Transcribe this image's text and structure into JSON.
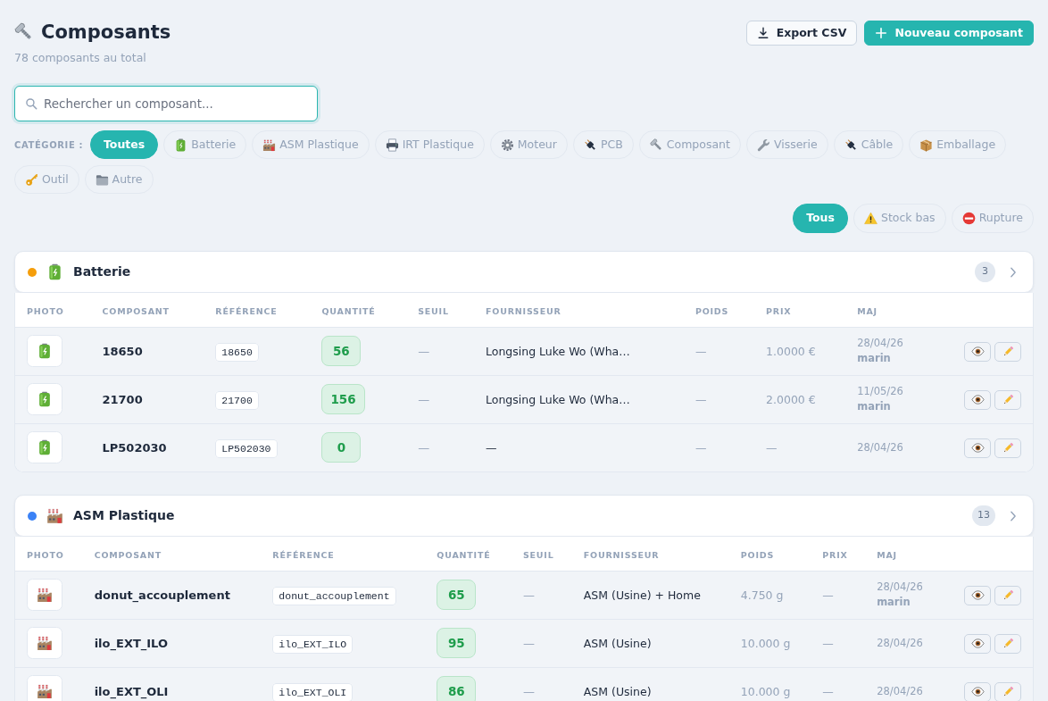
{
  "header": {
    "title": "Composants",
    "subtitle": "78 composants au total"
  },
  "actions": [
    {
      "label": "Export CSV",
      "kind": "export"
    },
    {
      "label": "Nouveau composant",
      "kind": "create"
    }
  ],
  "search": {
    "placeholder": "Rechercher un composant..."
  },
  "category_filter": {
    "label": "CATÉGORIE :",
    "chips": [
      {
        "label": "Toutes",
        "kind": "all",
        "selected": true
      },
      {
        "label": "Batterie",
        "kind": "battery",
        "selected": false
      },
      {
        "label": "ASM Plastique",
        "kind": "factory",
        "selected": false
      },
      {
        "label": "IRT Plastique",
        "kind": "printer",
        "selected": false
      },
      {
        "label": "Moteur",
        "kind": "gear",
        "selected": false
      },
      {
        "label": "PCB",
        "kind": "plug",
        "selected": false
      },
      {
        "label": "Composant",
        "kind": "bolt",
        "selected": false
      },
      {
        "label": "Visserie",
        "kind": "wrench",
        "selected": false
      },
      {
        "label": "Câble",
        "kind": "plug",
        "selected": false
      },
      {
        "label": "Emballage",
        "kind": "package",
        "selected": false
      },
      {
        "label": "Outil",
        "kind": "key",
        "selected": false
      },
      {
        "label": "Autre",
        "kind": "folder",
        "selected": false
      }
    ]
  },
  "stock_filter": [
    {
      "label": "Tous",
      "kind": "all",
      "selected": true
    },
    {
      "label": "Stock bas",
      "kind": "warning",
      "selected": false
    },
    {
      "label": "Rupture",
      "kind": "blocked",
      "selected": false
    }
  ],
  "groups": [
    {
      "name": "Batterie",
      "kind": "battery",
      "color": "#f59e0b",
      "count": "3",
      "columns": [
        "PHOTO",
        "COMPOSANT",
        "RÉFÉRENCE",
        "QUANTITÉ",
        "SEUIL",
        "FOURNISSEUR",
        "POIDS",
        "PRIX",
        "MAJ"
      ],
      "rows": [
        {
          "name": "18650",
          "reference": "18650",
          "quantity": "56",
          "threshold": "—",
          "supplier": "Longsing Luke Wo (Wha…",
          "weight": "—",
          "price": "1.0000 €",
          "updated": "28/04/26",
          "updated_by": "marin"
        },
        {
          "name": "21700",
          "reference": "21700",
          "quantity": "156",
          "threshold": "—",
          "supplier": "Longsing Luke Wo (Wha…",
          "weight": "—",
          "price": "2.0000 €",
          "updated": "11/05/26",
          "updated_by": "marin"
        },
        {
          "name": "LP502030",
          "reference": "LP502030",
          "quantity": "0",
          "threshold": "—",
          "supplier": "—",
          "weight": "—",
          "price": "—",
          "updated": "28/04/26"
        }
      ]
    },
    {
      "name": "ASM Plastique",
      "kind": "factory",
      "color": "#3b82f6",
      "count": "13",
      "columns": [
        "PHOTO",
        "COMPOSANT",
        "RÉFÉRENCE",
        "QUANTITÉ",
        "SEUIL",
        "FOURNISSEUR",
        "POIDS",
        "PRIX",
        "MAJ"
      ],
      "rows": [
        {
          "name": "donut_accouplement",
          "reference": "donut_accouplement",
          "quantity": "65",
          "threshold": "—",
          "supplier": "ASM (Usine) + Home",
          "weight": "4.750 g",
          "price": "—",
          "updated": "28/04/26",
          "updated_by": "marin"
        },
        {
          "name": "ilo_EXT_ILO",
          "reference": "ilo_EXT_ILO",
          "quantity": "95",
          "threshold": "—",
          "supplier": "ASM (Usine)",
          "weight": "10.000 g",
          "price": "—",
          "updated": "28/04/26"
        },
        {
          "name": "ilo_EXT_OLI",
          "reference": "ilo_EXT_OLI",
          "quantity": "86",
          "threshold": "—",
          "supplier": "ASM (Usine)",
          "weight": "10.000 g",
          "price": "—",
          "updated": "28/04/26"
        }
      ]
    }
  ]
}
